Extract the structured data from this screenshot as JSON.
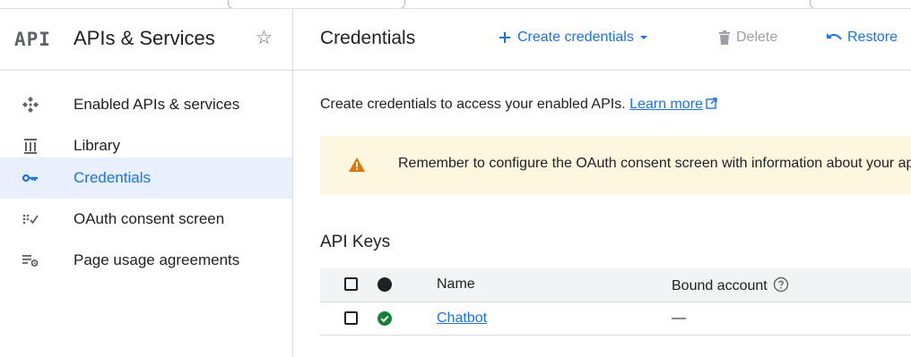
{
  "sidebar": {
    "logo": "API",
    "title": "APIs & Services",
    "items": [
      {
        "label": "Enabled APIs & services",
        "icon": "enabled-apis-icon"
      },
      {
        "label": "Library",
        "icon": "library-icon"
      },
      {
        "label": "Credentials",
        "icon": "key-icon",
        "active": true
      },
      {
        "label": "OAuth consent screen",
        "icon": "oauth-consent-icon"
      },
      {
        "label": "Page usage agreements",
        "icon": "settings-list-icon"
      }
    ]
  },
  "header": {
    "title": "Credentials",
    "create_label": "Create credentials",
    "delete_label": "Delete",
    "restore_label": "Restore"
  },
  "intro": {
    "text": "Create credentials to access your enabled APIs.",
    "link": "Learn more"
  },
  "banner": {
    "text": "Remember to configure the OAuth consent screen with information about your application."
  },
  "api_keys": {
    "title": "API Keys",
    "columns": {
      "name": "Name",
      "bound": "Bound account"
    },
    "rows": [
      {
        "name": "Chatbot",
        "bound": "—",
        "status": "active"
      }
    ]
  },
  "colors": {
    "accent": "#1a73e8",
    "active_bg": "#e8f0fe",
    "warning": "#e37400",
    "success": "#188038",
    "banner_bg": "#fef7e0"
  }
}
